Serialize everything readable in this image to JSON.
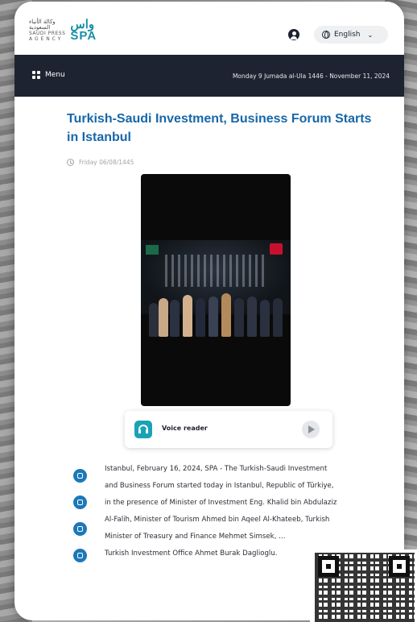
{
  "header": {
    "logo_small_lines": [
      "وكالة الأنباء",
      "السعودية",
      "SAUDI PRESS",
      "A G E N C Y"
    ],
    "logo_wordmark_top": "واس",
    "logo_wordmark_bottom": "SPA",
    "language_label": "English",
    "language_chevron": "⌄"
  },
  "navbar": {
    "menu_label": "Menu",
    "date": "Monday 9 Jumada al-Ula 1446 - November 11, 2024"
  },
  "article": {
    "title": "Turkish-Saudi Investment, Business Forum Starts in Istanbul",
    "published": "Friday 06/08/1445",
    "voice_reader_label": "Voice reader",
    "body_lines": [
      "Istanbul, February 16, 2024, SPA - The Turkish-Saudi Investment",
      "and Business Forum started today in Istanbul, Republic of Türkiye,",
      "in the presence of Minister of Investment Eng. Khalid bin Abdulaziz",
      "Al-Falih, Minister of Tourism Ahmed bin Aqeel Al-Khateeb, Turkish",
      "Minister of Treasury and Finance Mehmet Simsek, …",
      "Turkish Investment Office Ahmet Burak Daglioglu."
    ]
  },
  "icons": {
    "user": "user-icon",
    "language": "globe-icon",
    "menu": "grid-menu-icon",
    "date": "clock-icon",
    "voice": "headphones-icon",
    "play": "play-icon",
    "side_actions": [
      "thumbs-up-icon",
      "bookmark-icon",
      "print-icon",
      "share-icon"
    ]
  },
  "colors": {
    "title": "#1767a8",
    "navbar": "#1d2330",
    "accent": "#1aa3b4",
    "side_icon": "#1c78b8"
  }
}
